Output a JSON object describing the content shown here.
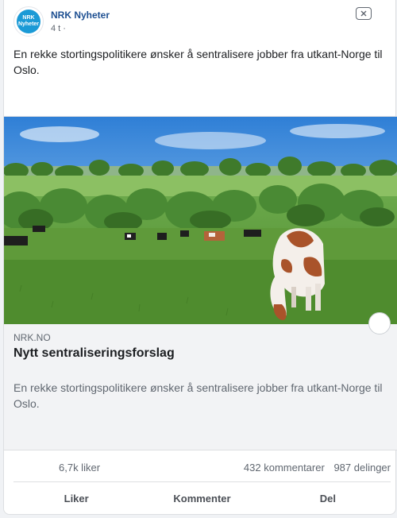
{
  "post": {
    "page_name": "NRK Nyheter",
    "avatar_text_line1": "NRK",
    "avatar_text_line2": "Nyheter",
    "time": "4 t",
    "separator": "·",
    "text": "En rekke stortingspolitikere ønsker å sentralisere jobber fra utkant-Norge til Oslo."
  },
  "link": {
    "domain": "NRK.NO",
    "title": "Nytt sentraliseringsforslag",
    "description": "En rekke stortingspolitikere ønsker å sentralisere jobber fra utkant-Norge til Oslo."
  },
  "stats": {
    "likes": "6,7k liker",
    "comments": "432 kommentarer",
    "shares": "987 delinger"
  },
  "actions": {
    "like": "Liker",
    "comment": "Kommenter",
    "share": "Del"
  },
  "colors": {
    "brand": "#1b9ad6",
    "page_name": "#1d4f91",
    "secondary_text": "#606770"
  },
  "icons": {
    "close": "close-icon",
    "avatar": "nrk-logo"
  }
}
